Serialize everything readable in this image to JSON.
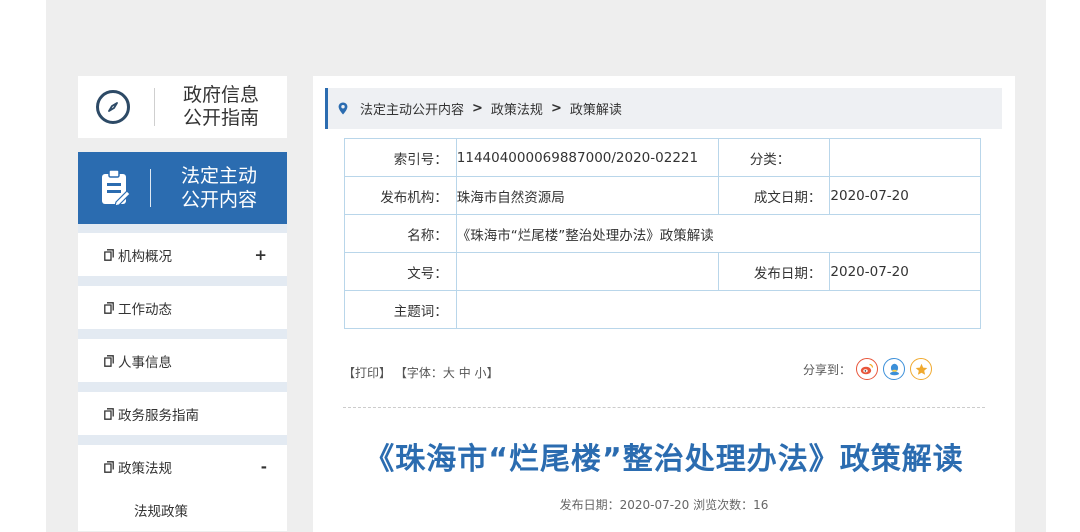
{
  "sidebar": {
    "guide_label_1": "政府信息",
    "guide_label_2": "公开指南",
    "active_label_1": "法定主动",
    "active_label_2": "公开内容",
    "items": [
      {
        "label": "机构概况",
        "sign": "+"
      },
      {
        "label": "工作动态",
        "sign": ""
      },
      {
        "label": "人事信息",
        "sign": ""
      },
      {
        "label": "政务服务指南",
        "sign": ""
      },
      {
        "label": "政策法规",
        "sign": "-"
      }
    ],
    "sub_items": [
      "法规政策"
    ],
    "icons": [
      "compass-icon",
      "clipboard-icon",
      "document-icon"
    ],
    "accent_color": "#2b6cb0"
  },
  "breadcrumb": {
    "icon": "location-pin-icon",
    "crumbs": [
      "法定主动公开内容",
      "政策法规",
      "政策解读"
    ],
    "separator": ">"
  },
  "meta": {
    "index_label": "索引号：",
    "index_value": "114404000069887000/2020-02221",
    "category_label": "分类：",
    "category_value": "",
    "publisher_label": "发布机构：",
    "publisher_value": "珠海市自然资源局",
    "written_date_label": "成文日期：",
    "written_date_value": "2020-07-20",
    "name_label": "名称：",
    "name_value": "《珠海市“烂尾楼”整治处理办法》政策解读",
    "docno_label": "文号：",
    "docno_value": "",
    "publish_date_label": "发布日期：",
    "publish_date_value": "2020-07-20",
    "keywords_label": "主题词：",
    "keywords_value": ""
  },
  "tools": {
    "print": "【打印】",
    "font_prefix": "【字体：",
    "font_large": "大",
    "font_medium": "中",
    "font_small": "小",
    "font_suffix": "】",
    "share_label": "分享到：",
    "share_icons": [
      "weibo-icon",
      "qq-icon",
      "qzone-star-icon"
    ]
  },
  "article": {
    "title": "《珠海市“烂尾楼”整治处理办法》政策解读",
    "publish_info": "发布日期：2020-07-20  浏览次数：16"
  }
}
